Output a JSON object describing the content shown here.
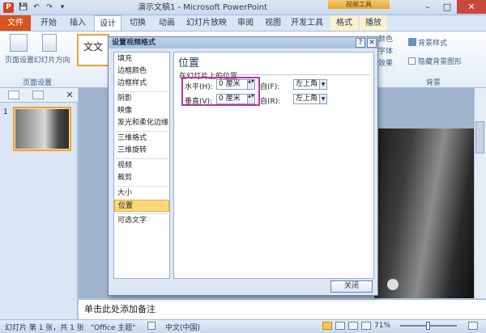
{
  "window": {
    "title": "演示文稿1 - Microsoft PowerPoint",
    "app_icon": "P",
    "context_tab_header": "视频工具",
    "controls": {
      "minimize": "–",
      "maximize": "□",
      "close": "✕"
    }
  },
  "quick_access": {
    "save": "💾",
    "undo": "↶",
    "redo": "↷",
    "customize": "▾"
  },
  "tabs": [
    {
      "label": "文件"
    },
    {
      "label": "开始"
    },
    {
      "label": "插入"
    },
    {
      "label": "设计"
    },
    {
      "label": "切换"
    },
    {
      "label": "动画"
    },
    {
      "label": "幻灯片放映"
    },
    {
      "label": "审阅"
    },
    {
      "label": "视图"
    },
    {
      "label": "开发工具"
    },
    {
      "label": "格式"
    },
    {
      "label": "播放"
    }
  ],
  "ribbon": {
    "page_setup": "页面设置",
    "orientation": "幻灯片方向",
    "group_page_setup": "页面设置",
    "theme_sample": "文文",
    "colors": "颜色",
    "fonts": "字体",
    "effects": "效果",
    "bg_styles": "背景样式",
    "hide_bg": "隐藏背景图形",
    "group_bg": "背景"
  },
  "left_panel": {
    "slide_number": "1",
    "close": "✕"
  },
  "dialog": {
    "title": "设置视频格式",
    "help": "?",
    "close": "✕",
    "categories": [
      "填充",
      "边框颜色",
      "边框样式",
      "阴影",
      "映像",
      "发光和柔化边缘",
      "三维格式",
      "三维旋转",
      "视频",
      "裁剪",
      "大小",
      "位置",
      "可选文字"
    ],
    "selected_category": "位置",
    "section_title": "位置",
    "subsection": "在幻灯片上的位置",
    "horizontal_label": "水平(H):",
    "horizontal_value": "0 厘米",
    "horizontal_from_label": "自(F):",
    "horizontal_from_value": "左上角",
    "vertical_label": "垂直(V):",
    "vertical_value": "0 厘米",
    "vertical_from_label": "自(R):",
    "vertical_from_value": "左上角",
    "close_button": "关闭"
  },
  "notes_placeholder": "单击此处添加备注",
  "statusbar": {
    "slide_info": "幻灯片 第 1 张，共 1 张",
    "theme": "\"Office 主题\"",
    "language": "中文(中国)",
    "zoom": "71%"
  }
}
